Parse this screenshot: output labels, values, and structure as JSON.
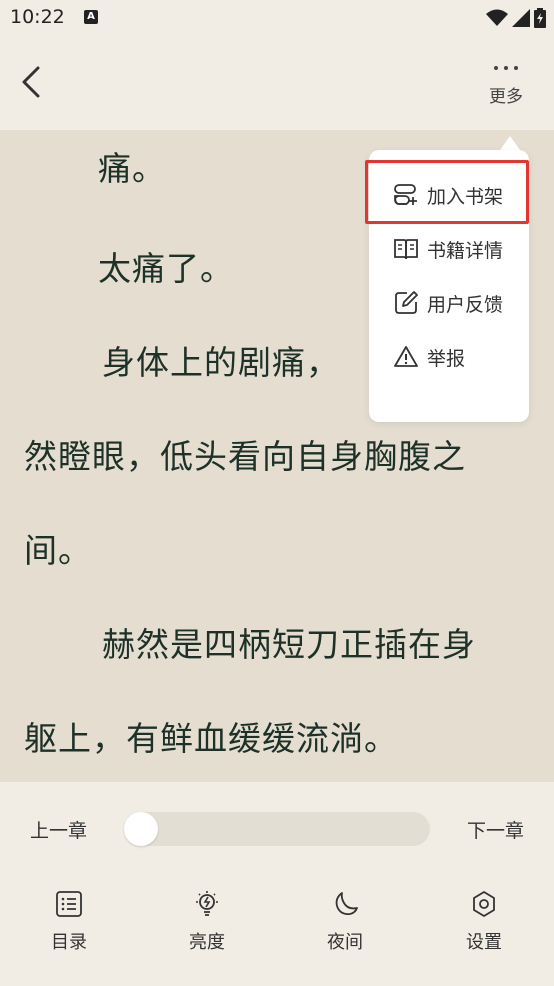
{
  "status_bar": {
    "time": "10:22",
    "a_icon_text": "A"
  },
  "header": {
    "more_label": "更多"
  },
  "reader": {
    "paragraphs": [
      "痛。",
      "太痛了。",
      "身体上的剧痛，",
      "然瞪眼，低头看向自身胸腹之",
      "间。",
      "赫然是四柄短刀正插在身",
      "躯上，有鲜血缓缓流淌。"
    ]
  },
  "menu": {
    "items": [
      {
        "label": "加入书架",
        "icon": "add-to-shelf-icon"
      },
      {
        "label": "书籍详情",
        "icon": "book-open-icon"
      },
      {
        "label": "用户反馈",
        "icon": "edit-feedback-icon"
      },
      {
        "label": "举报",
        "icon": "warning-icon"
      }
    ],
    "highlight_color": "#e43630"
  },
  "chapter_nav": {
    "prev_label": "上一章",
    "next_label": "下一章",
    "progress": 0
  },
  "toolbar": {
    "tabs": [
      {
        "label": "目录",
        "icon": "list-icon"
      },
      {
        "label": "亮度",
        "icon": "brightness-icon"
      },
      {
        "label": "夜间",
        "icon": "moon-icon"
      },
      {
        "label": "设置",
        "icon": "settings-icon"
      }
    ]
  },
  "colors": {
    "background": "#e4ddd0",
    "panel": "#f1ede4",
    "text": "#1e3128"
  }
}
